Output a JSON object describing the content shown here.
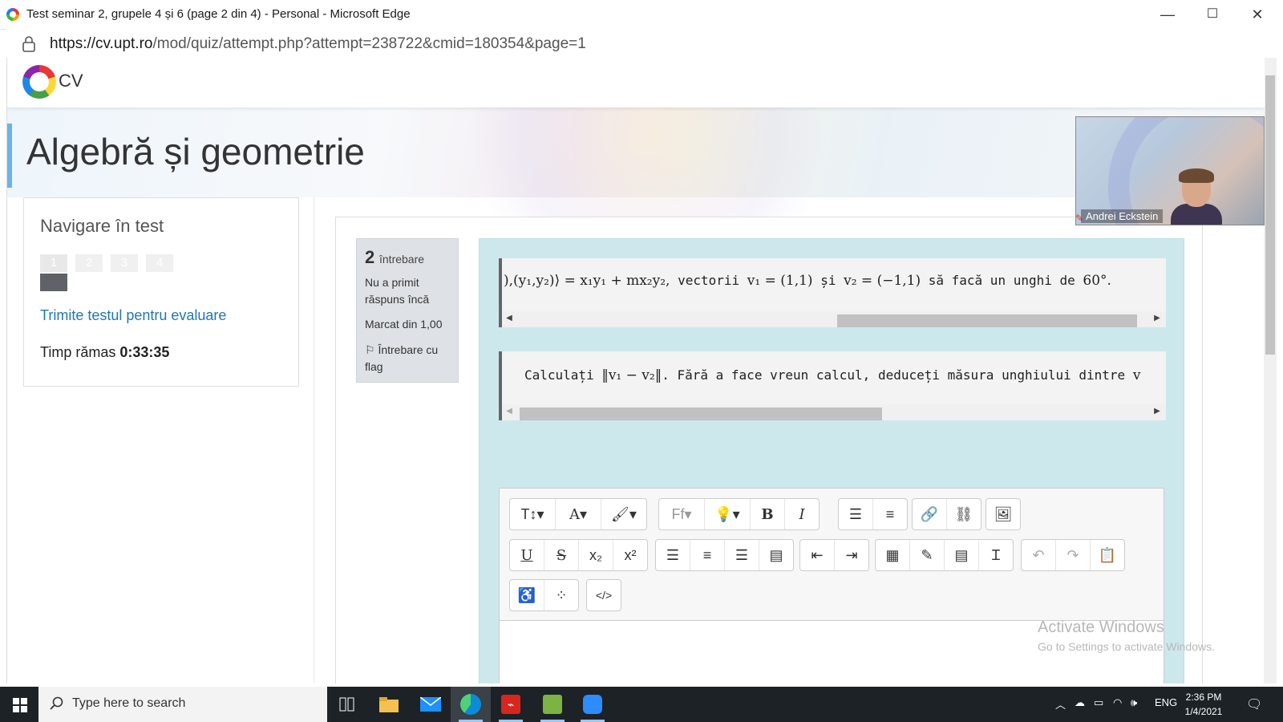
{
  "window": {
    "title": "Test seminar 2, grupele 4 și 6 (page 2 din 4) - Personal - Microsoft Edge",
    "minimize": "—",
    "maximize": "☐",
    "close": "✕"
  },
  "addressbar": {
    "url_host": "https://cv.upt.ro",
    "url_path": "/mod/quiz/attempt.php?attempt=238722&cmid=180354&page=1"
  },
  "site": {
    "logo_text": "CV"
  },
  "course": {
    "title": "Algebră și geometrie"
  },
  "quiz_nav": {
    "heading": "Navigare în test",
    "questions": [
      "1",
      "2",
      "3",
      "4"
    ],
    "current_question": 1,
    "submit_link": "Trimite testul pentru evaluare",
    "timer_label": "Timp rămas",
    "timer_value": "0:33:35"
  },
  "question_info": {
    "number": "2",
    "number_word": "întrebare",
    "state": "Nu a primit răspuns încă",
    "grade": "Marcat din 1,00",
    "flag": "Întrebare cu flag"
  },
  "question": {
    "line1_math": "),(y₁,y₂)⟩ = x₁y₁ + mx₂y₂,",
    "line1_text": " vectorii ",
    "line1_math2": "v₁ = (1,1)",
    "line1_text2": " și ",
    "line1_math3": "v₂ = (−1,1)",
    "line1_text3": " să facă un unghi de ",
    "line1_math4": "60°.",
    "line2_text": "Calculați ",
    "line2_math": "‖v₁ − v₂‖",
    "line2_text2": ". Fără a face vreun calcul, deduceți măsura unghiului dintre ",
    "line2_math2": "v"
  },
  "scrollbars": {
    "line1_position": 0.55,
    "line2_position": 0.0
  },
  "editor_toolbar": {
    "row1": [
      "paragraph-styles",
      "font-color",
      "background-color",
      "font-family",
      "clear-formatting",
      "bold",
      "italic",
      "unordered-list",
      "ordered-list",
      "link",
      "unlink",
      "image"
    ],
    "row2": [
      "underline",
      "strikethrough",
      "subscript",
      "superscript",
      "align-left",
      "align-center",
      "align-right",
      "align-justify",
      "outdent",
      "indent",
      "calculator",
      "edit",
      "table",
      "text-cursor",
      "undo",
      "redo",
      "paste"
    ],
    "row3": [
      "accessibility",
      "special-chars",
      "html-source"
    ],
    "glyphs": {
      "bold": "B",
      "italic": "I",
      "underline": "U",
      "strikethrough": "S",
      "subscript": "x₂",
      "superscript": "x²",
      "html-source": "</>",
      "undo": "↶",
      "redo": "↷",
      "clear-formatting": "💡"
    }
  },
  "video": {
    "participant": "Andrei Eckstein"
  },
  "watermark": {
    "line1": "Activate Windows",
    "line2": "Go to Settings to activate Windows."
  },
  "taskbar": {
    "search_placeholder": "Type here to search",
    "language": "ENG",
    "time": "2:36 PM",
    "date": "1/4/2021"
  },
  "colors": {
    "link": "#1f77b4",
    "formulation_bg": "#cce8ec",
    "info_bg": "#dee2e6",
    "taskbar": "#1c2226"
  }
}
